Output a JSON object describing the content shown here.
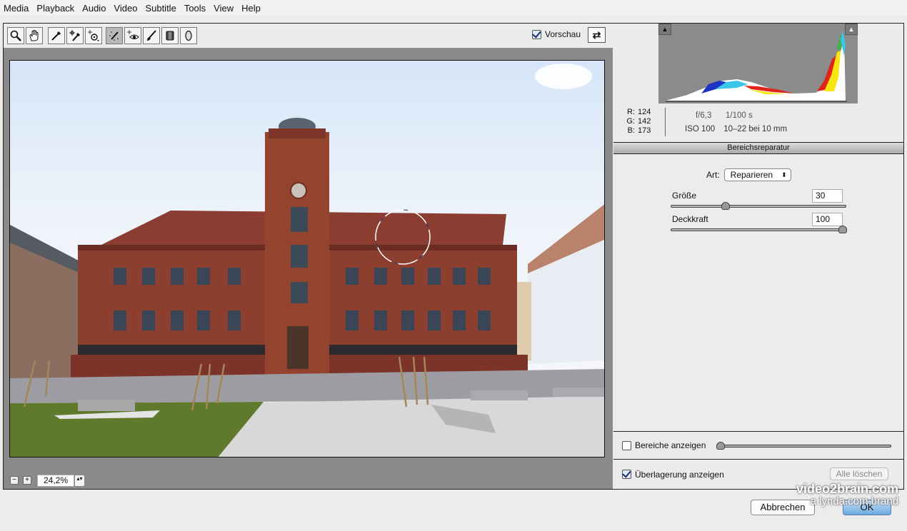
{
  "menubar": {
    "items": [
      "Media",
      "Playback",
      "Audio",
      "Video",
      "Subtitle",
      "Tools",
      "View",
      "Help"
    ]
  },
  "toolbar": {
    "tools": [
      {
        "name": "zoom-tool",
        "icon": "magnifier-icon",
        "active": false
      },
      {
        "name": "hand-tool",
        "icon": "hand-icon",
        "active": false
      },
      {
        "name": "white-balance-tool",
        "icon": "eyedropper-icon",
        "active": false
      },
      {
        "name": "color-sampler-tool",
        "icon": "color-sampler-icon",
        "active": false
      },
      {
        "name": "targeted-adjustment-tool",
        "icon": "target-adjust-icon",
        "active": false
      },
      {
        "name": "spot-removal-tool",
        "icon": "spot-removal-brush-icon",
        "active": true
      },
      {
        "name": "red-eye-tool",
        "icon": "red-eye-icon",
        "active": false
      },
      {
        "name": "adjustment-brush-tool",
        "icon": "brush-icon",
        "active": false
      },
      {
        "name": "graduated-filter-tool",
        "icon": "graduated-filter-icon",
        "active": false
      },
      {
        "name": "radial-filter-tool",
        "icon": "radial-filter-icon",
        "active": false
      }
    ],
    "preview_label": "Vorschau",
    "preview_checked": true,
    "swap_icon": "⇄"
  },
  "zoom": {
    "minus": "−",
    "plus": "+",
    "value": "24,2%",
    "stepper": "▴▾"
  },
  "histogram": {
    "shadow_clip_icon": "▲",
    "highlight_clip_icon": "▲"
  },
  "readout": {
    "r_label": "R:",
    "r_value": "124",
    "g_label": "G:",
    "g_value": "142",
    "b_label": "B:",
    "b_value": "173",
    "aperture": "f/6,3",
    "shutter": "1/100 s",
    "iso": "ISO 100",
    "lens": "10–22 bei 10 mm"
  },
  "panel": {
    "title": "Bereichsreparatur",
    "art_label": "Art:",
    "art_value": "Reparieren",
    "size_label": "Größe",
    "size_value": "30",
    "size_fraction": 0.3,
    "opacity_label": "Deckkraft",
    "opacity_value": "100",
    "opacity_fraction": 1.0
  },
  "footer": {
    "bereiche_label": "Bereiche anzeigen",
    "bereiche_checked": false,
    "ueberlagerung_label": "Überlagerung anzeigen",
    "ueberlagerung_checked": true,
    "alle_loeschen": "Alle löschen"
  },
  "buttons": {
    "cancel": "Abbrechen",
    "ok": "OK"
  },
  "watermark": {
    "line1": "video2brain.com",
    "line2": "a lynda.com brand"
  }
}
